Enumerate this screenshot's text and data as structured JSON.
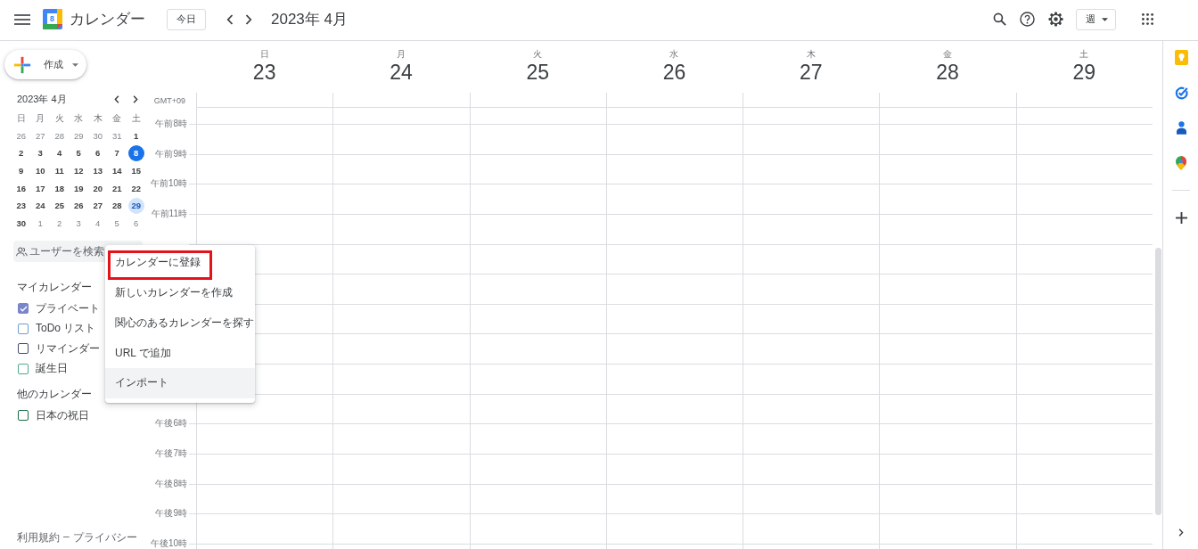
{
  "header": {
    "app_title": "カレンダー",
    "logo_day": "8",
    "today_button": "今日",
    "period_title": "2023年 4月",
    "view_button": "週"
  },
  "sidebar": {
    "create_button": "作成",
    "mini_calendar": {
      "title": "2023年 4月",
      "weekdays": [
        "日",
        "月",
        "火",
        "水",
        "木",
        "金",
        "土"
      ],
      "weeks": [
        [
          {
            "day": "26",
            "outside": true,
            "today": false,
            "selected": false
          },
          {
            "day": "27",
            "outside": true,
            "today": false,
            "selected": false
          },
          {
            "day": "28",
            "outside": true,
            "today": false,
            "selected": false
          },
          {
            "day": "29",
            "outside": true,
            "today": false,
            "selected": false
          },
          {
            "day": "30",
            "outside": true,
            "today": false,
            "selected": false
          },
          {
            "day": "31",
            "outside": true,
            "today": false,
            "selected": false
          },
          {
            "day": "1",
            "outside": false,
            "today": false,
            "selected": false
          }
        ],
        [
          {
            "day": "2",
            "outside": false,
            "today": false,
            "selected": false
          },
          {
            "day": "3",
            "outside": false,
            "today": false,
            "selected": false
          },
          {
            "day": "4",
            "outside": false,
            "today": false,
            "selected": false
          },
          {
            "day": "5",
            "outside": false,
            "today": false,
            "selected": false
          },
          {
            "day": "6",
            "outside": false,
            "today": false,
            "selected": false
          },
          {
            "day": "7",
            "outside": false,
            "today": false,
            "selected": false
          },
          {
            "day": "8",
            "outside": false,
            "today": true,
            "selected": false
          }
        ],
        [
          {
            "day": "9",
            "outside": false,
            "today": false,
            "selected": false
          },
          {
            "day": "10",
            "outside": false,
            "today": false,
            "selected": false
          },
          {
            "day": "11",
            "outside": false,
            "today": false,
            "selected": false
          },
          {
            "day": "12",
            "outside": false,
            "today": false,
            "selected": false
          },
          {
            "day": "13",
            "outside": false,
            "today": false,
            "selected": false
          },
          {
            "day": "14",
            "outside": false,
            "today": false,
            "selected": false
          },
          {
            "day": "15",
            "outside": false,
            "today": false,
            "selected": false
          }
        ],
        [
          {
            "day": "16",
            "outside": false,
            "today": false,
            "selected": false
          },
          {
            "day": "17",
            "outside": false,
            "today": false,
            "selected": false
          },
          {
            "day": "18",
            "outside": false,
            "today": false,
            "selected": false
          },
          {
            "day": "19",
            "outside": false,
            "today": false,
            "selected": false
          },
          {
            "day": "20",
            "outside": false,
            "today": false,
            "selected": false
          },
          {
            "day": "21",
            "outside": false,
            "today": false,
            "selected": false
          },
          {
            "day": "22",
            "outside": false,
            "today": false,
            "selected": false
          }
        ],
        [
          {
            "day": "23",
            "outside": false,
            "today": false,
            "selected": false
          },
          {
            "day": "24",
            "outside": false,
            "today": false,
            "selected": false
          },
          {
            "day": "25",
            "outside": false,
            "today": false,
            "selected": false
          },
          {
            "day": "26",
            "outside": false,
            "today": false,
            "selected": false
          },
          {
            "day": "27",
            "outside": false,
            "today": false,
            "selected": false
          },
          {
            "day": "28",
            "outside": false,
            "today": false,
            "selected": false
          },
          {
            "day": "29",
            "outside": false,
            "today": false,
            "selected": true
          }
        ],
        [
          {
            "day": "30",
            "outside": false,
            "today": false,
            "selected": false
          },
          {
            "day": "1",
            "outside": true,
            "today": false,
            "selected": false
          },
          {
            "day": "2",
            "outside": true,
            "today": false,
            "selected": false
          },
          {
            "day": "3",
            "outside": true,
            "today": false,
            "selected": false
          },
          {
            "day": "4",
            "outside": true,
            "today": false,
            "selected": false
          },
          {
            "day": "5",
            "outside": true,
            "today": false,
            "selected": false
          },
          {
            "day": "6",
            "outside": true,
            "today": false,
            "selected": false
          }
        ]
      ]
    },
    "search": {
      "placeholder": "ユーザーを検索"
    },
    "my_calendars": {
      "title": "マイカレンダー",
      "items": [
        {
          "label": "プライベート",
          "checked": true,
          "color": "#7986cb"
        },
        {
          "label": "ToDo リスト",
          "checked": false,
          "color": "#6d9ece"
        },
        {
          "label": "リマインダー",
          "checked": false,
          "color": "#3f4a6e"
        },
        {
          "label": "誕生日",
          "checked": false,
          "color": "#4fa987"
        }
      ]
    },
    "other_calendars": {
      "title": "他のカレンダー",
      "items": [
        {
          "label": "日本の祝日",
          "checked": false,
          "color": "#1e6a48"
        }
      ]
    },
    "footer": {
      "links": [
        "利用規約",
        "プライバシー"
      ],
      "separator": "–"
    }
  },
  "week_view": {
    "days": [
      {
        "weekday": "日",
        "date": "23"
      },
      {
        "weekday": "月",
        "date": "24"
      },
      {
        "weekday": "火",
        "date": "25"
      },
      {
        "weekday": "水",
        "date": "26"
      },
      {
        "weekday": "木",
        "date": "27"
      },
      {
        "weekday": "金",
        "date": "28"
      },
      {
        "weekday": "土",
        "date": "29"
      }
    ],
    "timezone": "GMT+09",
    "time_labels_morning": [
      "午前8時",
      "午前9時",
      "午前10時",
      "午前11時"
    ],
    "time_labels_evening": [
      "午後6時",
      "午後7時",
      "午後8時",
      "午後9時",
      "午後10時"
    ]
  },
  "add_calendar_menu": {
    "items": [
      {
        "label": "カレンダーに登録",
        "hovered": false,
        "annotated": true
      },
      {
        "label": "新しいカレンダーを作成",
        "hovered": false,
        "annotated": false
      },
      {
        "label": "関心のあるカレンダーを探す",
        "hovered": false,
        "annotated": false
      },
      {
        "label": "URL で追加",
        "hovered": false,
        "annotated": false
      },
      {
        "label": "インポート",
        "hovered": true,
        "annotated": false
      }
    ]
  }
}
